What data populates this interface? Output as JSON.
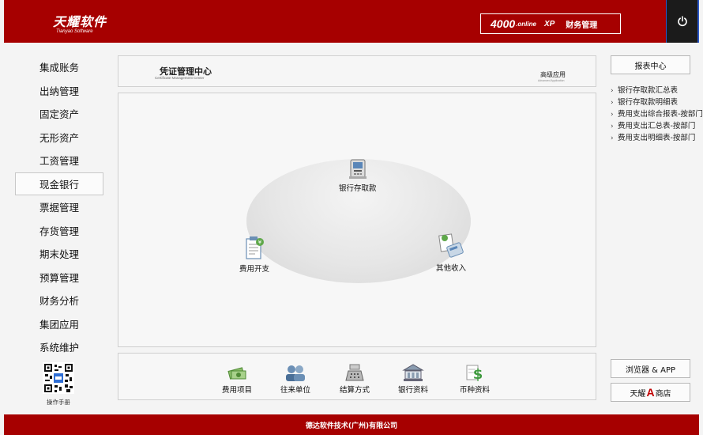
{
  "header": {
    "logo_text": "天耀软件",
    "logo_sub": "Tianyao Software",
    "product_number": "4000",
    "product_suffix": ".online",
    "product_edition": "XP",
    "product_name": "财务管理"
  },
  "nav": {
    "items": [
      {
        "label": "集成账务"
      },
      {
        "label": "出纳管理"
      },
      {
        "label": "固定资产"
      },
      {
        "label": "无形资产"
      },
      {
        "label": "工资管理"
      },
      {
        "label": "现金银行"
      },
      {
        "label": "票据管理"
      },
      {
        "label": "存货管理"
      },
      {
        "label": "期末处理"
      },
      {
        "label": "预算管理"
      },
      {
        "label": "财务分析"
      },
      {
        "label": "集团应用"
      },
      {
        "label": "系统维护"
      }
    ],
    "active_index": 5,
    "manual_label": "操作手册"
  },
  "title_bar": {
    "title": "凭证管理中心",
    "subtitle": "Certificate Management Center",
    "advanced": "高级应用",
    "advanced_sub": "Advanced Application"
  },
  "flow": {
    "bank_deposit": "银行存取款",
    "expense": "费用开支",
    "other_income": "其他收入"
  },
  "bottom_tools": [
    {
      "label": "费用项目"
    },
    {
      "label": "往来单位"
    },
    {
      "label": "结算方式"
    },
    {
      "label": "银行资料"
    },
    {
      "label": "币种资料"
    }
  ],
  "right": {
    "report_center": "报表中心",
    "reports": [
      "银行存取款汇总表",
      "银行存取款明细表",
      "费用支出综合报表-按部门",
      "费用支出汇总表-按部门",
      "费用支出明细表-按部门"
    ],
    "browser_app": "浏览器 & APP",
    "ashop_prefix": "天耀",
    "ashop_a": "A",
    "ashop_suffix": "商店"
  },
  "footer": {
    "company": "德达软件技术(广州)有限公司"
  },
  "colors": {
    "brand_red": "#a60000",
    "power_bg": "#1b1b1b",
    "accent_blue": "#2a56c6"
  }
}
